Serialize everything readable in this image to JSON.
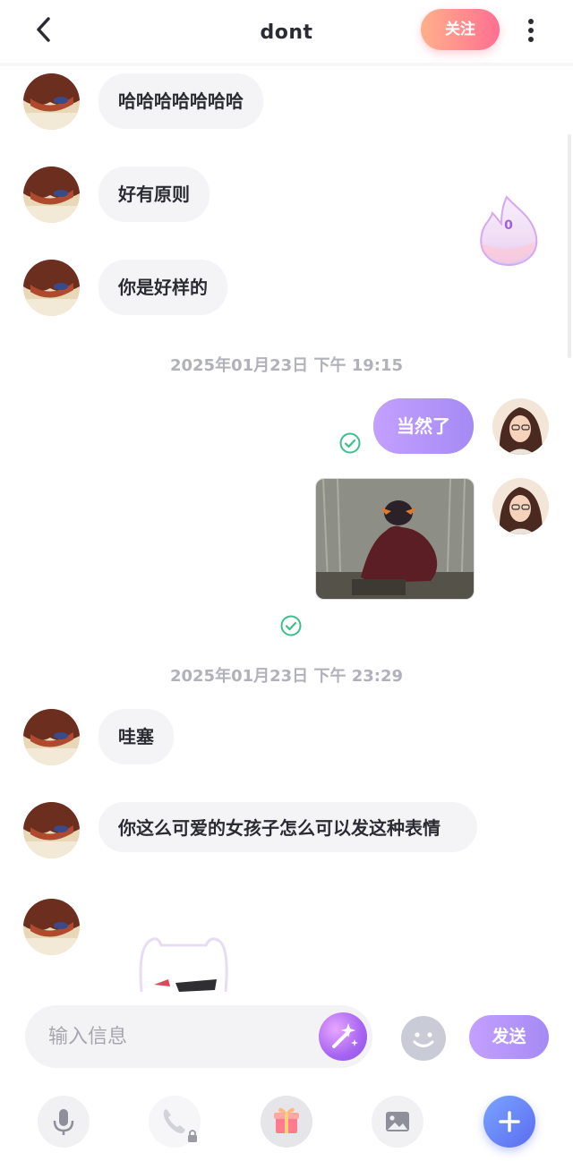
{
  "header": {
    "title": "dont",
    "follow_label": "关注"
  },
  "fire_badge": {
    "count": "0"
  },
  "messages": [
    {
      "side": "left",
      "text": "哈哈哈哈哈哈哈"
    },
    {
      "side": "left",
      "text": "好有原则"
    },
    {
      "side": "left",
      "text": "你是好样的"
    },
    {
      "type": "timestamp",
      "text": "2025年01月23日 下午 19:15"
    },
    {
      "side": "right",
      "text": "当然了"
    },
    {
      "type": "timestamp",
      "text": "2025年01月23日 下午 23:29"
    },
    {
      "side": "left",
      "text": "哇塞"
    },
    {
      "side": "left",
      "text": "你这么可爱的女孩子怎么可以发这种表情"
    }
  ],
  "input": {
    "placeholder": "输入信息",
    "send_label": "发送"
  },
  "toolbar": [
    "mic-icon",
    "phone-locked-icon",
    "gift-icon",
    "image-icon",
    "plus-icon"
  ],
  "colors": {
    "accent": "#a58af4",
    "follow": "#ff6f91",
    "bubble_left": "#f4f4f6",
    "check": "#3cc08a"
  }
}
